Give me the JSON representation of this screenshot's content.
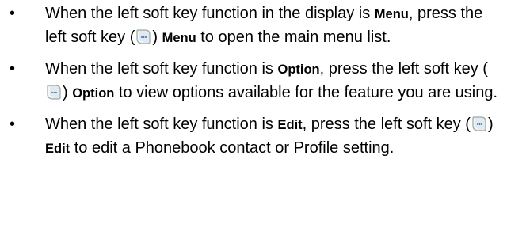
{
  "bullets": [
    {
      "marker": "•",
      "p1": "When the left soft key function in the display is ",
      "kw1": "Menu",
      "p2": ", press the left soft key (",
      "p3": ") ",
      "kw2": "Menu",
      "p4": " to open the main menu list."
    },
    {
      "marker": "•",
      "p1": "When the left soft key function is ",
      "kw1": "Option",
      "p2": ", press the left soft key (",
      "p3": ") ",
      "kw2": "Option",
      "p4": " to view options available for the feature you are using."
    },
    {
      "marker": "•",
      "p1": "When the left soft key function is ",
      "kw1": "Edit",
      "p2": ", press the left soft key (",
      "p3": ") ",
      "kw2": "Edit",
      "p4": " to edit a Phonebook contact or Profile setting."
    }
  ],
  "icons": {
    "softkey": "left-softkey-icon"
  },
  "colors": {
    "text": "#000000",
    "icon_fill": "#e3eaec",
    "icon_stroke": "#9aa9ad",
    "icon_dots": "#3b6fd0"
  }
}
